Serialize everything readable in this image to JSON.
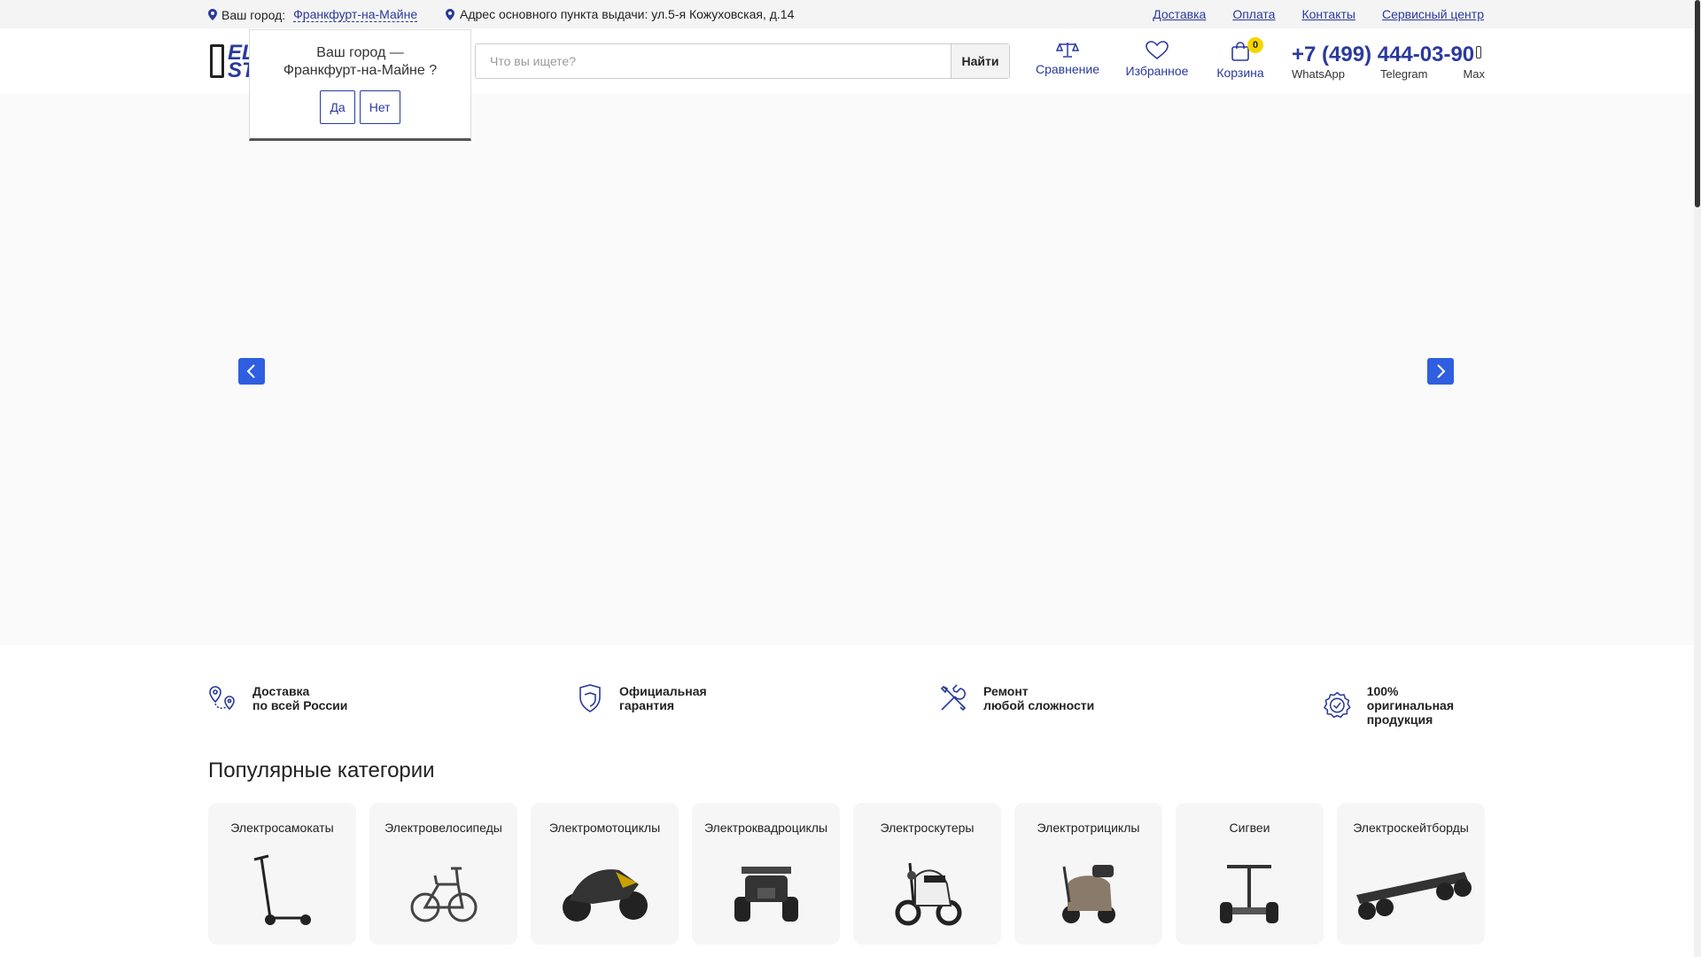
{
  "topbar": {
    "city_label": "Ваш город:",
    "city_value": "Франкфурт-на-Майне",
    "address": "Адрес основного пункта выдачи: ул.5-я Кожуховская, д.14",
    "links": [
      "Доставка",
      "Оплата",
      "Контакты",
      "Сервисный центр"
    ]
  },
  "header": {
    "logo_line1": "EL",
    "logo_line2": "ST",
    "search_placeholder": "Что вы ищете?",
    "search_button": "Найти",
    "compare_label": "Сравнение",
    "favorites_label": "Избранное",
    "cart_label": "Корзина",
    "cart_count": "0",
    "phone": "+7 (499) 444-03-90",
    "messengers": [
      "WhatsApp",
      "Telegram",
      "Max"
    ]
  },
  "city_popup": {
    "question_line1": "Ваш город —",
    "question_line2": "Франкфурт-на-Майне ?",
    "yes_label": "Да",
    "no_label": "Нет"
  },
  "features": [
    {
      "line1": "Доставка",
      "line2": "по всей России"
    },
    {
      "line1": "Официальная",
      "line2": "гарантия"
    },
    {
      "line1": "Ремонт",
      "line2": "любой сложности"
    },
    {
      "line1": "100% оригинальная",
      "line2": "продукция"
    }
  ],
  "categories_title": "Популярные категории",
  "categories": [
    "Электросамокаты",
    "Электровелосипеды",
    "Электромотоциклы",
    "Электроквадроциклы",
    "Электроскутеры",
    "Электротрициклы",
    "Сигвеи",
    "Электроскейтборды"
  ],
  "colors": {
    "brand_blue": "#2a3a9c",
    "arrow_blue": "#2f5fe0",
    "badge_yellow": "#f4d600"
  }
}
